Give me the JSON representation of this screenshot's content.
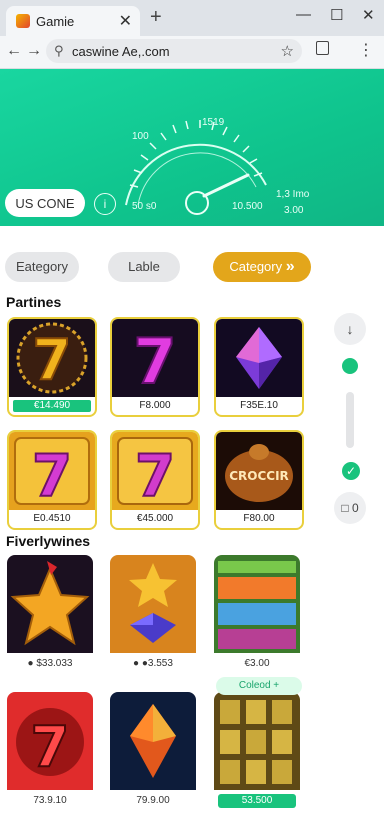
{
  "browser": {
    "tab_title": "Gamie",
    "tab_close": "✕",
    "new_tab": "+",
    "url": "caswine Ae,.com",
    "win_min": "—",
    "win_max": "☐",
    "win_close": "✕"
  },
  "hero": {
    "button_label": "US CONE",
    "info_icon": "i",
    "gauge_labels": {
      "top_left": "100",
      "top_mid": "1519",
      "left": "50 s0",
      "center": "10.500",
      "right_a": "1,3 Imo",
      "right_b": "3.00"
    }
  },
  "categories": {
    "left": "Eategory",
    "mid": "Lable",
    "active": "Category",
    "active_icon": "»"
  },
  "section1": {
    "title": "Partines",
    "cards": [
      {
        "price": "€14.490",
        "green": true
      },
      {
        "price": "F8.000",
        "green": false
      },
      {
        "price": "F35E.10",
        "green": false
      },
      {
        "price": "E0.4510",
        "green": false
      },
      {
        "price": "€45.000",
        "green": false
      },
      {
        "price": "F80.00",
        "green": false
      }
    ],
    "card_art_text": "CROCCIR"
  },
  "section2": {
    "title": "Fiverlywines",
    "cards": [
      {
        "price": "● $33.033",
        "green": false
      },
      {
        "price": "● ●3.553",
        "green": false
      },
      {
        "price": "€3.00",
        "green": false
      },
      {
        "price": "73.9.10",
        "green": false
      },
      {
        "price": "79.9.00",
        "green": false
      },
      {
        "price": "53.500",
        "green": true
      }
    ],
    "overlay_pill": "Coleod +"
  },
  "side": {
    "down_icon": "↓",
    "check_icon": "✓",
    "lock_label": "0"
  },
  "colors": {
    "hero_green": "#10c48c",
    "accent_gold": "#e3a61b",
    "price_green": "#19c37d",
    "card_border": "#e9cf3c"
  }
}
